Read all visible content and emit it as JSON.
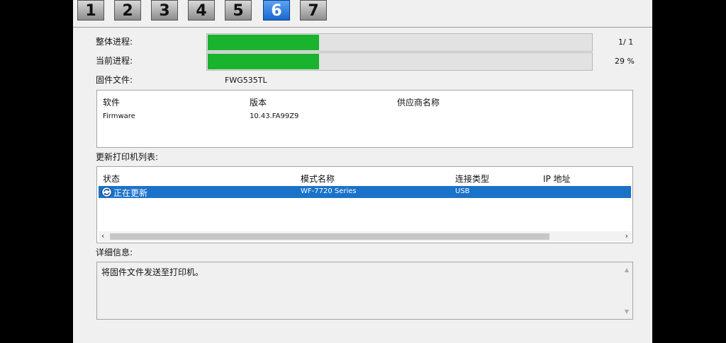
{
  "steps": [
    "1",
    "2",
    "3",
    "4",
    "5",
    "6",
    "7"
  ],
  "active_step": "6",
  "progress": {
    "overall_label": "整体进程:",
    "overall_value": "1/ 1",
    "overall_fraction": 0.29,
    "current_label": "当前进程:",
    "current_value": "29 %",
    "current_fraction": 0.29
  },
  "firmware": {
    "label": "固件文件:",
    "value": "FWG535TL"
  },
  "firmware_table": {
    "headers": [
      "软件",
      "版本",
      "供应商名称"
    ],
    "rows": [
      [
        "Firmware",
        "10.43.FA99Z9",
        ""
      ]
    ]
  },
  "printer_list": {
    "label": "更新打印机列表:",
    "headers": [
      "状态",
      "模式名称",
      "连接类型",
      "IP 地址"
    ],
    "rows": [
      {
        "status": "正在更新",
        "model": "WF-7720 Series",
        "connection": "USB",
        "ip": ""
      }
    ],
    "scroll_left": "‹",
    "scroll_right": "›"
  },
  "details": {
    "label": "详细信息:",
    "text": "将固件文件发送至打印机。"
  },
  "icons": {
    "status_icon": "refresh-icon"
  },
  "colors": {
    "progress_fill": "#19b32d",
    "selection": "#1a72c9",
    "active_step": "#2a7be0"
  }
}
